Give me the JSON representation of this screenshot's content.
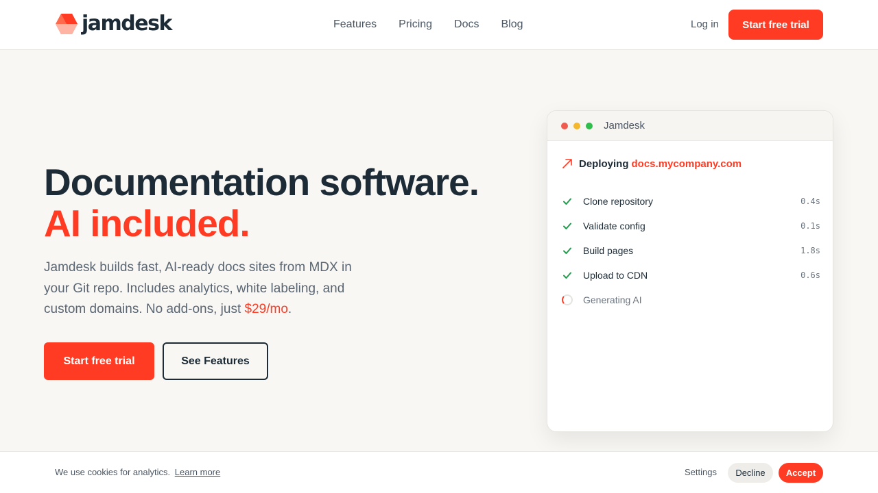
{
  "brand": {
    "name": "jamdesk",
    "accent_color": "#ff3b23"
  },
  "nav": [
    {
      "label": "Features"
    },
    {
      "label": "Pricing"
    },
    {
      "label": "Docs"
    },
    {
      "label": "Blog"
    }
  ],
  "header": {
    "login_label": "Log in",
    "cta_label": "Start free trial"
  },
  "hero": {
    "title_line1": "Documentation software.",
    "title_line2": "AI included.",
    "description": "Jamdesk builds fast, AI-ready docs sites from MDX in your Git repo. Includes analytics, white labeling, and custom domains. No add-ons, just ",
    "price": "$29/mo",
    "description_end": ".",
    "primary_cta": "Start free trial",
    "secondary_cta": "See Features"
  },
  "deploy_window": {
    "title": "Jamdesk",
    "deploy_prefix": "Deploying",
    "domain": "docs.mycompany.com",
    "steps": [
      {
        "label": "Clone repository",
        "time": "0.4s",
        "status": "done"
      },
      {
        "label": "Validate config",
        "time": "0.1s",
        "status": "done"
      },
      {
        "label": "Build pages",
        "time": "1.8s",
        "status": "done"
      },
      {
        "label": "Upload to CDN",
        "time": "0.6s",
        "status": "done"
      },
      {
        "label": "Generating AI",
        "time": "",
        "status": "in-progress"
      }
    ]
  },
  "cookie_bar": {
    "text": "We use cookies for analytics.",
    "learn_more": "Learn more",
    "settings": "Settings",
    "decline": "Decline",
    "accept": "Accept"
  }
}
